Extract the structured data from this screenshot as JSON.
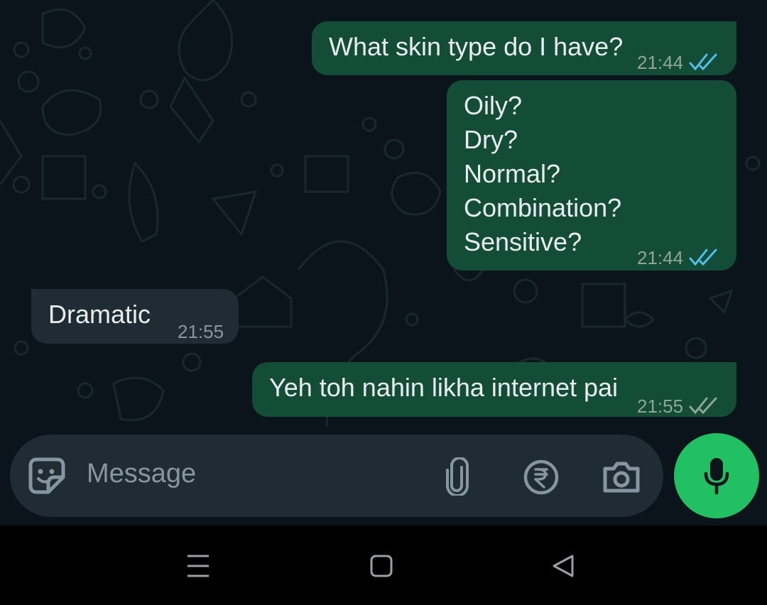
{
  "messages": [
    {
      "direction": "outgoing",
      "text": "What skin type do I have?",
      "time": "21:44",
      "status": "read"
    },
    {
      "direction": "outgoing",
      "text": "Oily?\nDry?\nNormal?\nCombination?\nSensitive?",
      "time": "21:44",
      "status": "read"
    },
    {
      "direction": "incoming",
      "text": "Dramatic",
      "time": "21:55"
    },
    {
      "direction": "outgoing",
      "text": "Yeh toh nahin likha internet pai",
      "time": "21:55",
      "status": "delivered"
    }
  ],
  "composer": {
    "placeholder": "Message",
    "icons": [
      "sticker-icon",
      "paperclip-icon",
      "rupee-payment-icon",
      "camera-icon",
      "microphone-icon"
    ]
  },
  "navigation": {
    "icons": [
      "menu-lines-icon",
      "home-square-icon",
      "back-triangle-icon"
    ]
  },
  "colors": {
    "chat_background": "#0b141a",
    "outgoing_bubble": "#144d37",
    "incoming_bubble": "#202c33",
    "read_tick": "#53bdeb",
    "delivered_tick": "#8fa59c",
    "mic_button": "#21c063",
    "input_background": "#1f2c33"
  }
}
